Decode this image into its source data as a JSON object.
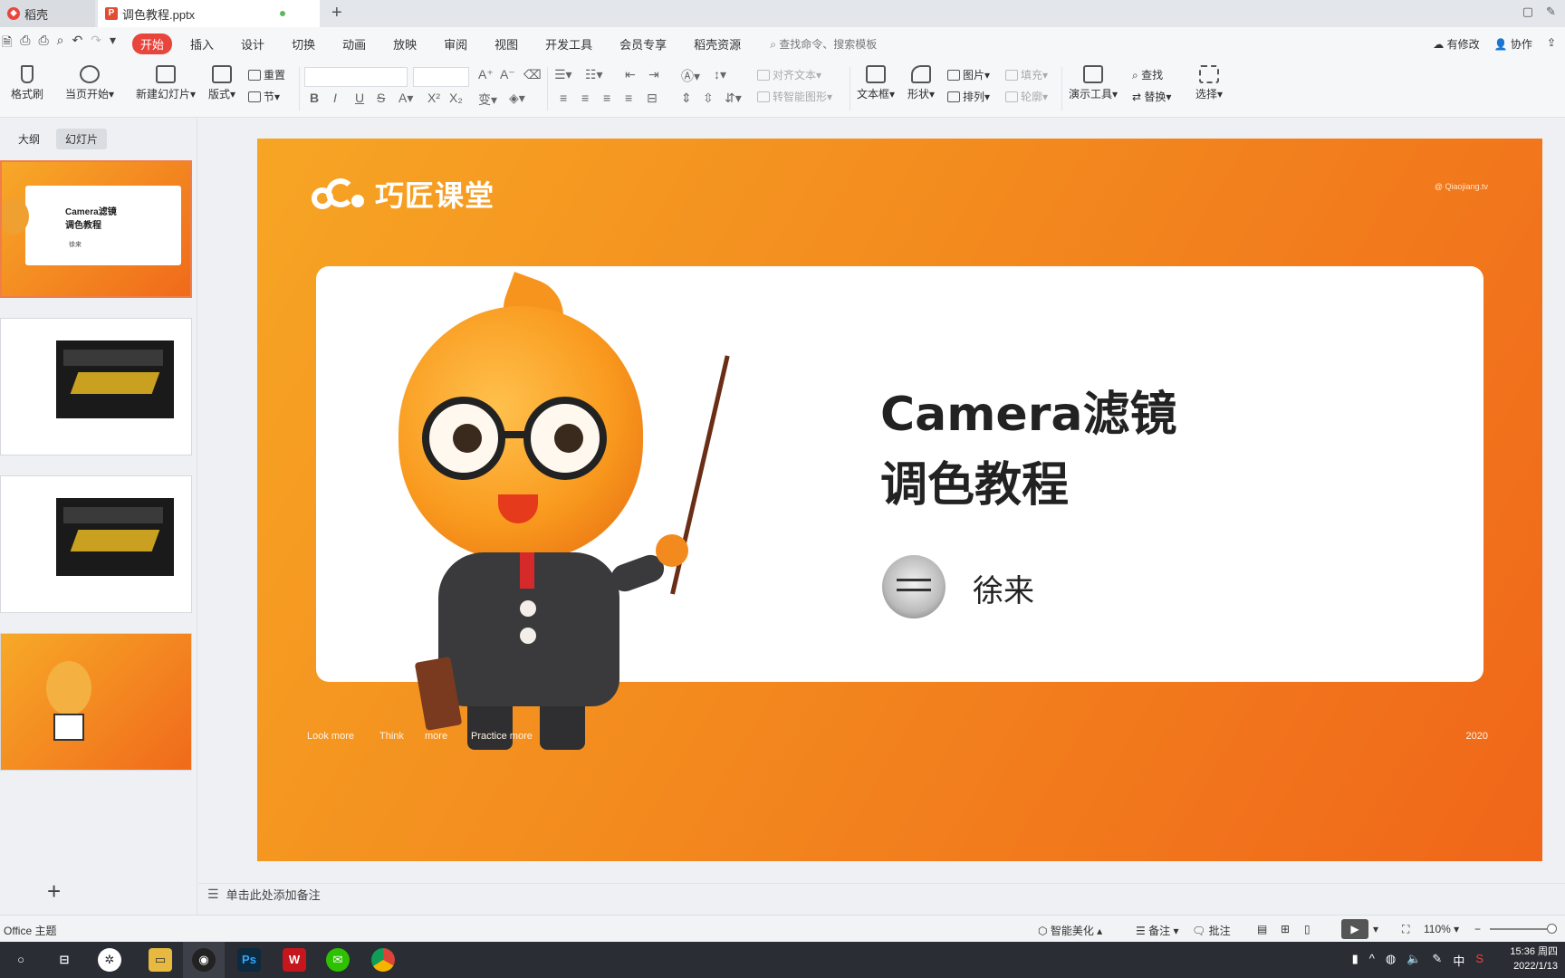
{
  "tabs": {
    "home": "稻壳",
    "doc": "调色教程.pptx",
    "add": "+"
  },
  "menu": {
    "items": [
      "开始",
      "插入",
      "设计",
      "切换",
      "动画",
      "放映",
      "审阅",
      "视图",
      "开发工具",
      "会员专享",
      "稻壳资源"
    ],
    "search": "查找命令、搜索模板",
    "modified": "有修改",
    "collab": "协作"
  },
  "ribbon": {
    "format_painter": "格式刷",
    "play_current": "当页开始",
    "new_slide": "新建幻灯片",
    "layout": "版式",
    "reset": "重置",
    "section": "节",
    "align_text": "对齐文本",
    "smart_shape": "转智能图形",
    "textbox": "文本框",
    "shape": "形状",
    "picture": "图片",
    "arrange": "排列",
    "fill": "填充",
    "outline": "轮廓",
    "present_tools": "演示工具",
    "find": "查找",
    "replace": "替换",
    "select": "选择"
  },
  "panel": {
    "outline_tab": "大纲",
    "slides_tab": "幻灯片",
    "thumb1_title_line1": "Camera滤镜",
    "thumb1_title_line2": "调色教程",
    "thumb1_author": "徐来",
    "add": "+"
  },
  "slide": {
    "logo": "巧匠课堂",
    "signature": "@ Qiaojiang.tv",
    "title_line1": "Camera滤镜",
    "title_line2": "调色教程",
    "author": "徐来",
    "footer": [
      "Look more",
      "Think",
      "more",
      "Practice more"
    ],
    "year": "2020"
  },
  "notes": {
    "placeholder": "单击此处添加备注"
  },
  "status": {
    "theme": "Office 主题",
    "beautify": "智能美化",
    "notes": "备注",
    "comment": "批注",
    "zoom": "110%"
  },
  "taskbar": {
    "time": "15:36 周四",
    "date": "2022/1/13",
    "ime": "中"
  }
}
